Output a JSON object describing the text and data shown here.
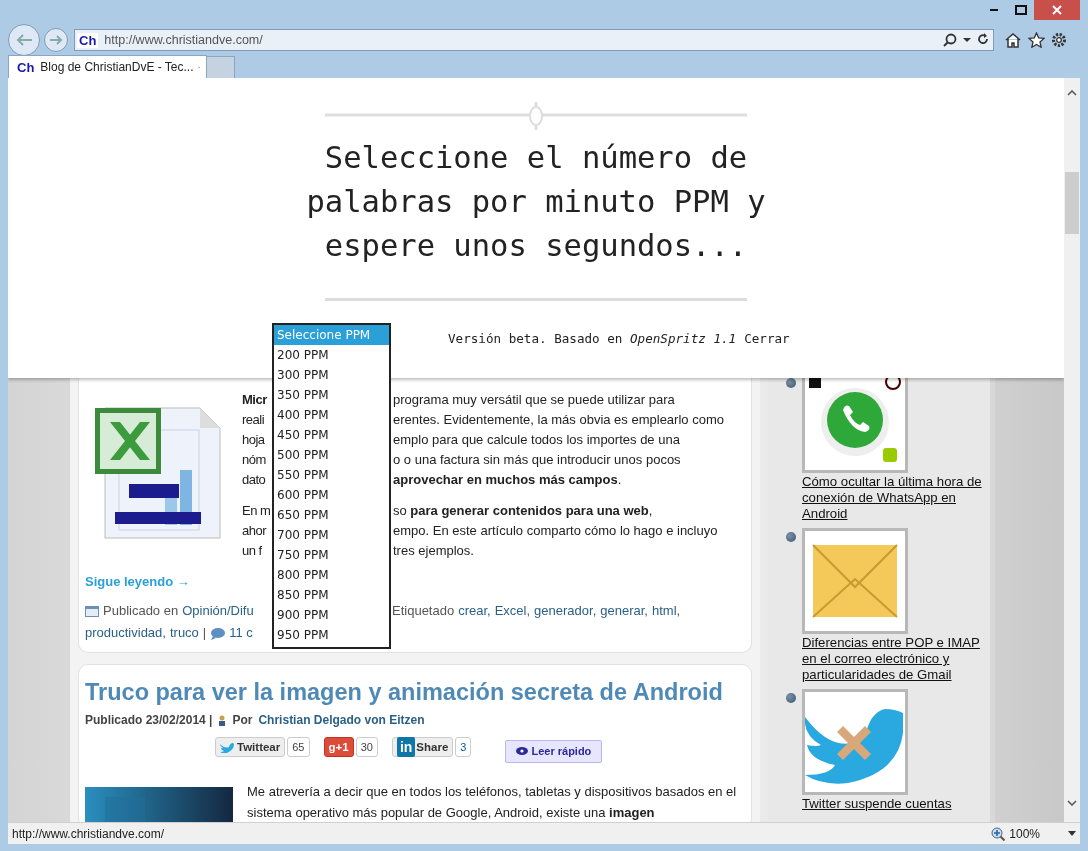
{
  "address_bar": {
    "favicon": "Ch",
    "url": "http://www.christiandve.com/"
  },
  "tabs": [
    {
      "favicon": "Ch",
      "title": "Blog de ChristianDvE - Tec...",
      "selected": true
    }
  ],
  "reader": {
    "prompt": "Seleccione el número de palabras por minuto PPM y espere unos segundos...",
    "info": "Versión beta. Basado en *OpenSpritz 1.1*",
    "close": "Cerrar"
  },
  "ppm_list": [
    {
      "label": "Seleccione PPM",
      "selected": true
    },
    {
      "label": "200 PPM",
      "selected": false
    },
    {
      "label": "300 PPM",
      "selected": false
    },
    {
      "label": "350 PPM",
      "selected": false
    },
    {
      "label": "400 PPM",
      "selected": false
    },
    {
      "label": "450 PPM",
      "selected": false
    },
    {
      "label": "500 PPM",
      "selected": false
    },
    {
      "label": "550 PPM",
      "selected": false
    },
    {
      "label": "600 PPM",
      "selected": false
    },
    {
      "label": "650 PPM",
      "selected": false
    },
    {
      "label": "700 PPM",
      "selected": false
    },
    {
      "label": "750 PPM",
      "selected": false
    },
    {
      "label": "800 PPM",
      "selected": false
    },
    {
      "label": "850 PPM",
      "selected": false
    },
    {
      "label": "900 PPM",
      "selected": false
    },
    {
      "label": "950 PPM",
      "selected": false
    }
  ],
  "article_1": {
    "paragraphs": [
      [
        {
          "left": "**Micr**",
          "right": "programa muy versátil que se puede utilizar para"
        },
        {
          "left": "reali",
          "right": "erentes. Evidentemente, la más obvia es emplearlo como"
        },
        {
          "left": "hoja",
          "right": "emplo para que calcule todos los importes de una"
        },
        {
          "left": "nóm",
          "right": "o o una factura sin más que introducir unos pocos"
        },
        {
          "left": "dato",
          "right": "**aprovechar en muchos más campos**."
        }
      ],
      [
        {
          "left": "En m",
          "right": "so **para generar contenidos para una web**,"
        },
        {
          "left": "ahor",
          "right": "empo. En este artículo comparto cómo lo hago e incluyo"
        },
        {
          "left": "un f",
          "right": "tres ejemplos."
        }
      ]
    ],
    "read_more": "Sigue leyendo →",
    "meta_rows": [
      {
        "left": [
          {
            "kind": "folder"
          },
          {
            "kind": "text",
            "text": "Publicado en"
          },
          {
            "kind": "link",
            "text": "Opinión/Difu"
          }
        ],
        "right": [
          {
            "kind": "text",
            "text": "Etiquetado"
          },
          {
            "kind": "link",
            "text": "crear,"
          },
          {
            "kind": "link",
            "text": "Excel,"
          },
          {
            "kind": "link",
            "text": "generador,"
          },
          {
            "kind": "link",
            "text": "generar,"
          },
          {
            "kind": "link",
            "text": "html,"
          }
        ]
      },
      {
        "left": [
          {
            "kind": "link",
            "text": "productividad,"
          },
          {
            "kind": "link",
            "text": "truco"
          },
          {
            "kind": "text",
            "text": "|"
          },
          {
            "kind": "comment"
          },
          {
            "kind": "link",
            "text": "11 c"
          }
        ],
        "right": []
      }
    ]
  },
  "article_2": {
    "title": "Truco para ver la imagen y animación secreta de Android",
    "date": "Publicado 23/02/2014 |",
    "by": "Por",
    "author": "Christian Delgado von Eitzen",
    "share": [
      {
        "kind": "twitter",
        "label": "Twittear",
        "count": "65"
      },
      {
        "kind": "gplus",
        "label": "g+1",
        "count": "30"
      },
      {
        "kind": "linkedin",
        "logo": "in",
        "label": "Share",
        "count": "3"
      }
    ],
    "read_fast": "Leer rápido",
    "excerpt": "Me atrevería a decir que en todos los teléfonos, tabletas y dispositivos basados en el sistema operativo más popular de Google, Android, existe una **imagen**"
  },
  "sidebar": [
    {
      "kind": "whatsapp",
      "title": "Cómo ocultar la última hora de conexión de WhatsApp en Android"
    },
    {
      "kind": "envelope",
      "title": "Diferencias entre POP e IMAP en el correo electrónico y particularidades de Gmail"
    },
    {
      "kind": "bird",
      "title": "Twitter suspende cuentas"
    }
  ],
  "status_bar": {
    "url": "http://www.christiandve.com/",
    "zoom": "100%"
  }
}
